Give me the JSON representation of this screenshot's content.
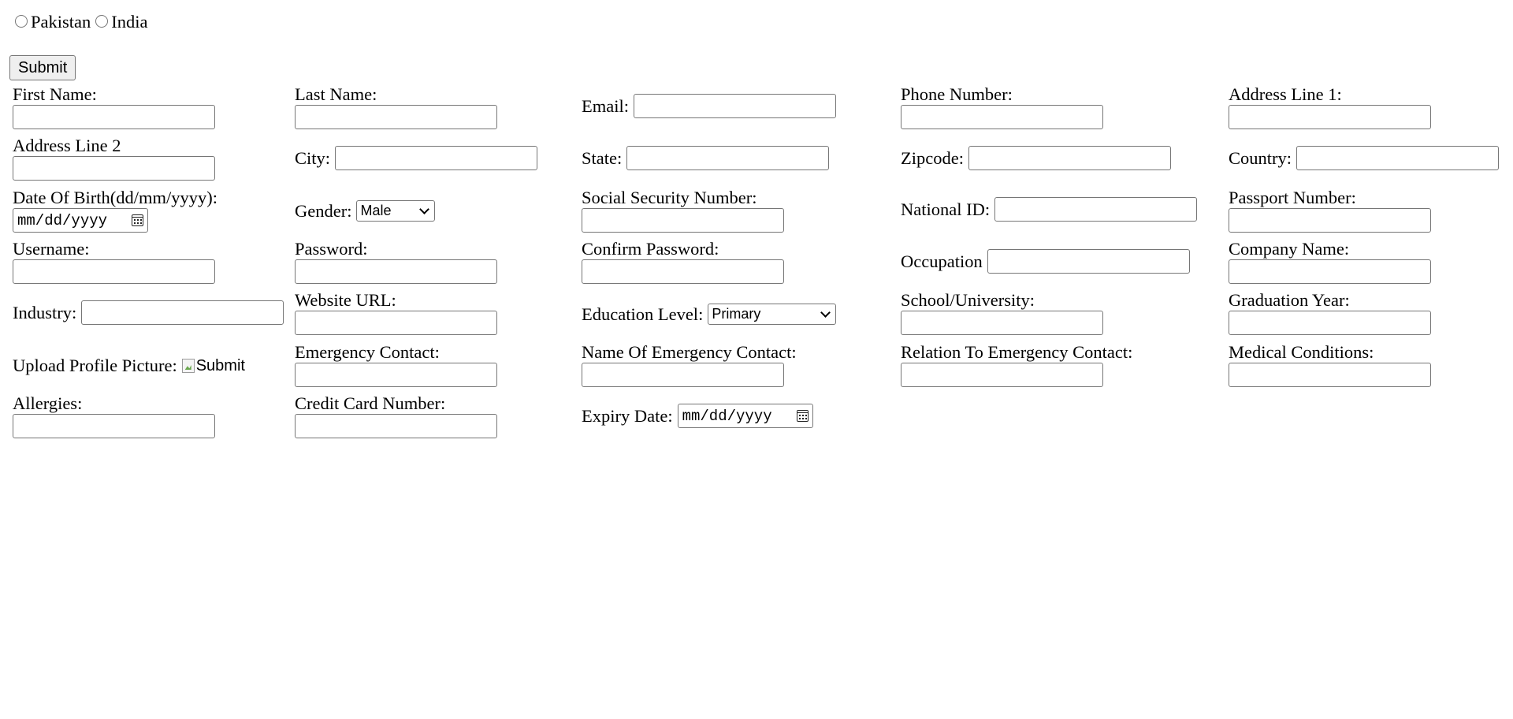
{
  "country_choice": {
    "options": [
      "Pakistan",
      "India"
    ]
  },
  "submit_button": {
    "label": "Submit"
  },
  "form": {
    "first_name": "First Name:",
    "last_name": "Last Name:",
    "email": "Email:",
    "phone": "Phone Number:",
    "address1": "Address Line 1:",
    "address2": "Address Line 2",
    "city": "City:",
    "state": "State:",
    "zipcode": "Zipcode:",
    "country": "Country:",
    "dob": "Date Of Birth(dd/mm/yyyy):",
    "dob_placeholder": "mm/dd/yyyy",
    "gender": "Gender:",
    "gender_value": "Male",
    "ssn": "Social Security Number:",
    "national_id": "National ID:",
    "passport": "Passport Number:",
    "username": "Username:",
    "password": "Password:",
    "confirm_password": "Confirm Password:",
    "occupation": "Occupation",
    "company": "Company Name:",
    "industry": "Industry:",
    "website": "Website URL:",
    "education": "Education Level:",
    "education_value": "Primary",
    "school": "School/University:",
    "grad_year": "Graduation Year:",
    "upload_picture": "Upload Profile Picture:",
    "upload_alt": "Submit",
    "emergency_contact": "Emergency Contact:",
    "emergency_name": "Name Of Emergency Contact:",
    "emergency_relation": "Relation To Emergency Contact:",
    "medical": "Medical Conditions:",
    "allergies": "Allergies:",
    "credit_card": "Credit Card Number:",
    "expiry": "Expiry Date:",
    "expiry_placeholder": "mm/dd/yyyy"
  }
}
